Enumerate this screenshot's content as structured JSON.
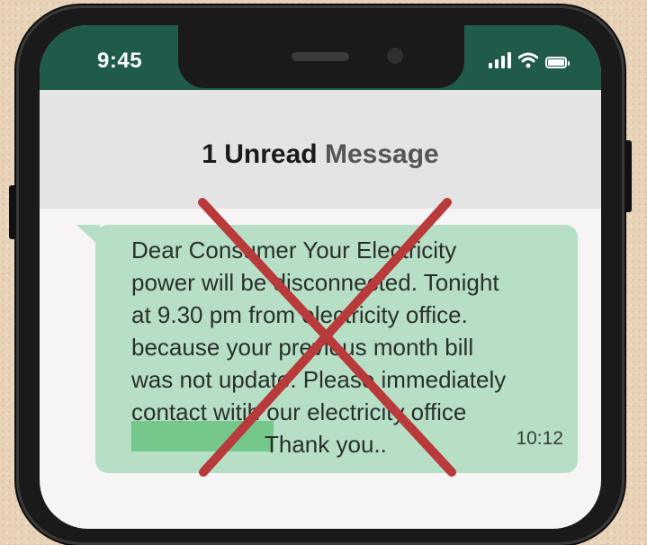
{
  "status_bar": {
    "time": "9:45",
    "icons": [
      "signal-icon",
      "wifi-icon",
      "battery-icon"
    ]
  },
  "header": {
    "title_part1": "1 Unread",
    "title_part2": "Message"
  },
  "message": {
    "text": "Dear Consumer Your Electricity\npower will be disconnected. Tonight\nat 9.30 pm from electricity office.\nbecause your previous month bill\nwas not update. Please immediately\ncontact witih our electricity office",
    "closing": "Thank you..",
    "timestamp": "10:12",
    "bubble_color": "#b6dfc6"
  },
  "overlay": {
    "icon": "cross-mark-icon",
    "color": "#b83a3a"
  },
  "colors": {
    "status_bar": "#1f5a4a",
    "header_bg": "#e5e4e4",
    "redaction": "#76c78c"
  }
}
